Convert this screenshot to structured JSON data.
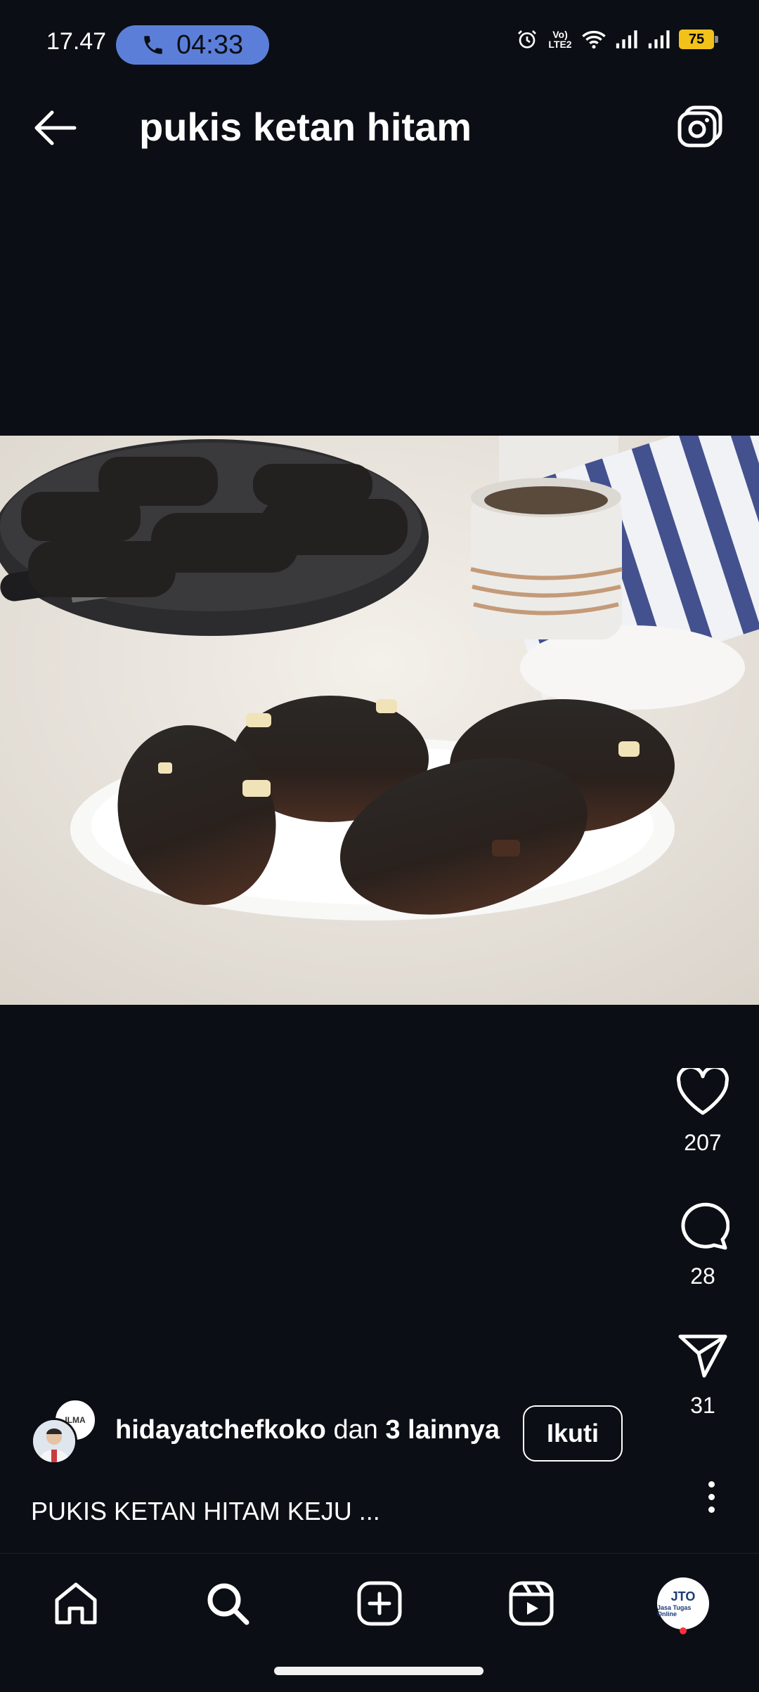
{
  "status_bar": {
    "time": "17.47",
    "call_timer": "04:33",
    "network_badge": "Vo) LTE2",
    "battery_level": "75",
    "icons": [
      "phone-icon",
      "alarm-icon",
      "volte-icon",
      "wifi-icon",
      "signal-icon",
      "signal-icon",
      "battery-icon"
    ]
  },
  "header": {
    "title": "pukis ketan hitam",
    "back_icon": "arrow-left-icon",
    "camera_icon": "camera-icon"
  },
  "post": {
    "image_subject": "pukis ketan hitam keju on a white plate with a pukis pan, cup and striped cloth",
    "likes": "207",
    "comments": "28",
    "shares": "31",
    "author_username": "hidayatchefkoko",
    "author_connector": "dan",
    "author_others": "3 lainnya",
    "follow_label": "Ikuti",
    "collab_avatar_text": "ILMA",
    "caption": "PUKIS KETAN HITAM KEJU ..."
  },
  "bottom_nav": {
    "items": [
      "home-icon",
      "search-icon",
      "add-post-icon",
      "reels-icon",
      "profile-avatar"
    ],
    "profile_initials": "JTO",
    "profile_subtext": "Jasa Tugas Online"
  },
  "colors": {
    "background": "#0b0e14",
    "call_pill": "#5b7fd9",
    "battery": "#f2c21b",
    "notification_dot": "#ff3040"
  }
}
